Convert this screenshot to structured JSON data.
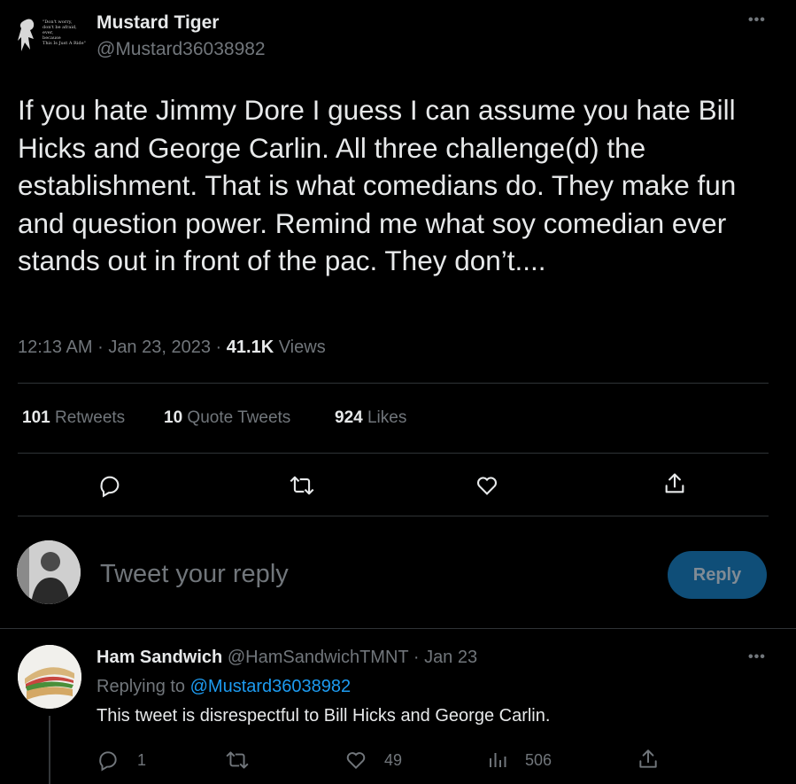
{
  "main_tweet": {
    "author_name": "Mustard Tiger",
    "author_handle": "@Mustard36038982",
    "avatar_text": [
      "\"Don't worry,",
      "don't be afraid,",
      "ever,",
      "because",
      "This Is Just A Ride\""
    ],
    "text": "If you hate Jimmy Dore I guess I can assume you hate Bill Hicks and George Carlin. All three challenge(d) the establishment. That is what comedians do. They make fun and question power. Remind me what soy comedian ever stands out in front of the pac. They don’t....",
    "time": "12:13 AM",
    "date": "Jan 23, 2023",
    "sep": "·",
    "views_count": "41.1K",
    "views_label": "Views",
    "more_icon": "more-horizontal-icon"
  },
  "stats": {
    "retweets_count": "101",
    "retweets_label": "Retweets",
    "quotes_count": "10",
    "quotes_label": "Quote Tweets",
    "likes_count": "924",
    "likes_label": "Likes"
  },
  "actions": [
    "reply-icon",
    "retweet-icon",
    "like-icon",
    "share-icon"
  ],
  "composer": {
    "placeholder": "Tweet your reply",
    "button_label": "Reply"
  },
  "reply": {
    "author_name": "Ham Sandwich",
    "author_handle": "@HamSandwichTMNT",
    "sep": "·",
    "date": "Jan 23",
    "replying_prefix": "Replying to",
    "replying_to": "@Mustard36038982",
    "text": "This tweet is disrespectful to Bill Hicks and George Carlin.",
    "reply_count": "1",
    "like_count": "49",
    "views_count": "506"
  },
  "colors": {
    "background": "#000000",
    "text": "#e7e9ea",
    "muted": "#71767b",
    "link": "#1d9bf0",
    "divider": "#2f3336",
    "reply_button_bg": "#0f4e78",
    "reply_button_text": "#808b95"
  }
}
